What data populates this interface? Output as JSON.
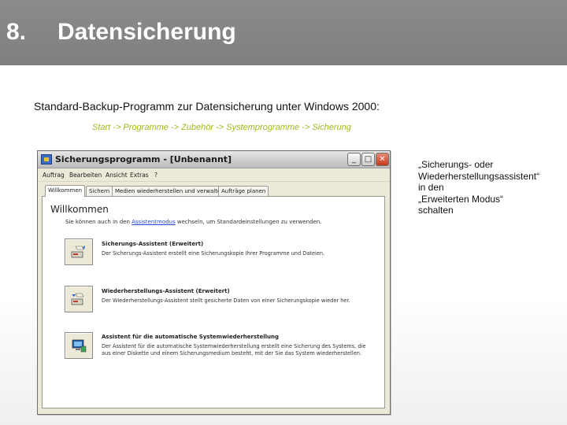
{
  "header": {
    "number": "8.",
    "title": "Datensicherung"
  },
  "intro": "Standard-Backup-Programm zur Datensicherung unter Windows 2000:",
  "path": "Start -> Programme -> Zubehör -> Systemprogramme -> Sicherung",
  "side_note": {
    "lines": [
      "„Sicherungs- oder",
      "Wiederherstellungsassistent“",
      "in den",
      "„Erweiterten Modus“",
      "schalten"
    ]
  },
  "window": {
    "title": "Sicherungsprogramm - [Unbenannt]",
    "buttons": {
      "minimize": "_",
      "maximize": "□",
      "close": "✕"
    },
    "menu": [
      "Auftrag",
      "Bearbeiten",
      "Ansicht",
      "Extras",
      "?"
    ],
    "tabs": [
      "Willkommen",
      "Sichern",
      "Medien wiederherstellen und verwalten",
      "Aufträge planen"
    ],
    "welcome_heading": "Willkommen",
    "welcome_text_before": "Sie können auch in den ",
    "welcome_link": "Assistentmodus",
    "welcome_text_after": " wechseln, um Standardeinstellungen zu verwenden.",
    "wizards": [
      {
        "title": "Sicherungs-Assistent (Erweitert)",
        "desc": [
          "Der Sicherungs-Assistent erstellt eine Sicherungskopie Ihrer Programme und Dateien."
        ],
        "icon": "backup-wizard-icon"
      },
      {
        "title": "Wiederherstellungs-Assistent (Erweitert)",
        "desc": [
          "Der Wiederherstellungs-Assistent stellt gesicherte Daten von einer Sicherungskopie wieder her."
        ],
        "icon": "restore-wizard-icon"
      },
      {
        "title": "Assistent für die automatische Systemwiederherstellung",
        "desc": [
          "Der Assistent für die automatische Systemwiederherstellung erstellt eine Sicherung des Systems, die",
          "aus einer Diskette und einem Sicherungsmedium besteht, mit der Sie das System wiederherstellen."
        ],
        "icon": "asr-wizard-icon"
      }
    ]
  },
  "colors": {
    "header_bg": "#858585",
    "path_text": "#9bbb1e",
    "link": "#2a4bd0"
  }
}
